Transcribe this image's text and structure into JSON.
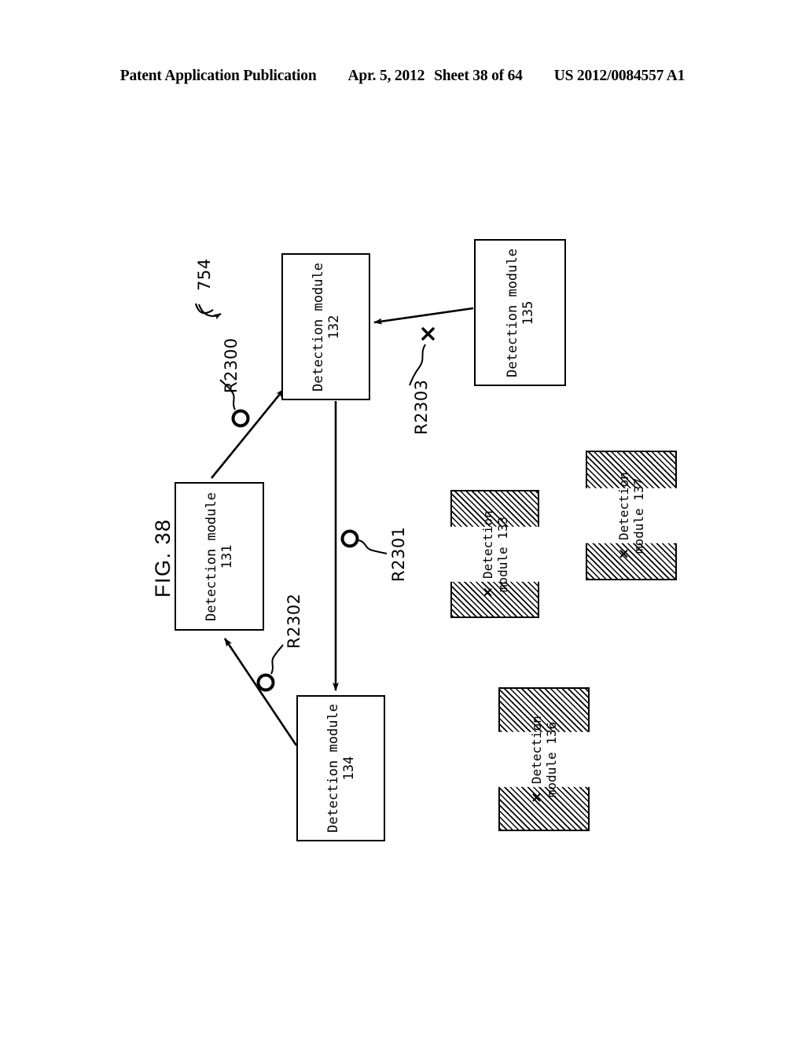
{
  "header": {
    "title": "Patent Application Publication",
    "date": "Apr. 5, 2012",
    "sheet": "Sheet 38 of 64",
    "number": "US 2012/0084557 A1"
  },
  "figure": {
    "label": "FIG. 38",
    "system_ref": "754",
    "modules": [
      {
        "id": "131",
        "name_line1": "Detection module",
        "name_line2": "131",
        "state": "active"
      },
      {
        "id": "132",
        "name_line1": "Detection module",
        "name_line2": "132",
        "state": "active"
      },
      {
        "id": "133",
        "name_line1": "Detection",
        "name_line2": "module 133",
        "state": "disabled",
        "mark": "×"
      },
      {
        "id": "134",
        "name_line1": "Detection module",
        "name_line2": "134",
        "state": "active"
      },
      {
        "id": "135",
        "name_line1": "Detection module",
        "name_line2": "135",
        "state": "active"
      },
      {
        "id": "136",
        "name_line1": "Detection",
        "name_line2": "module 136",
        "state": "disabled",
        "mark": "×"
      },
      {
        "id": "137",
        "name_line1": "Detection",
        "name_line2": "module 137",
        "state": "disabled",
        "mark": "×"
      }
    ],
    "relations": [
      {
        "ref": "R2300",
        "from": "131",
        "to": "132",
        "marker": "circle"
      },
      {
        "ref": "R2301",
        "from": "132",
        "to": "134",
        "marker": "circle"
      },
      {
        "ref": "R2302",
        "from": "134",
        "to": "131",
        "marker": "circle"
      },
      {
        "ref": "R2303",
        "from": "135",
        "to": "132",
        "marker": "cross"
      }
    ]
  }
}
